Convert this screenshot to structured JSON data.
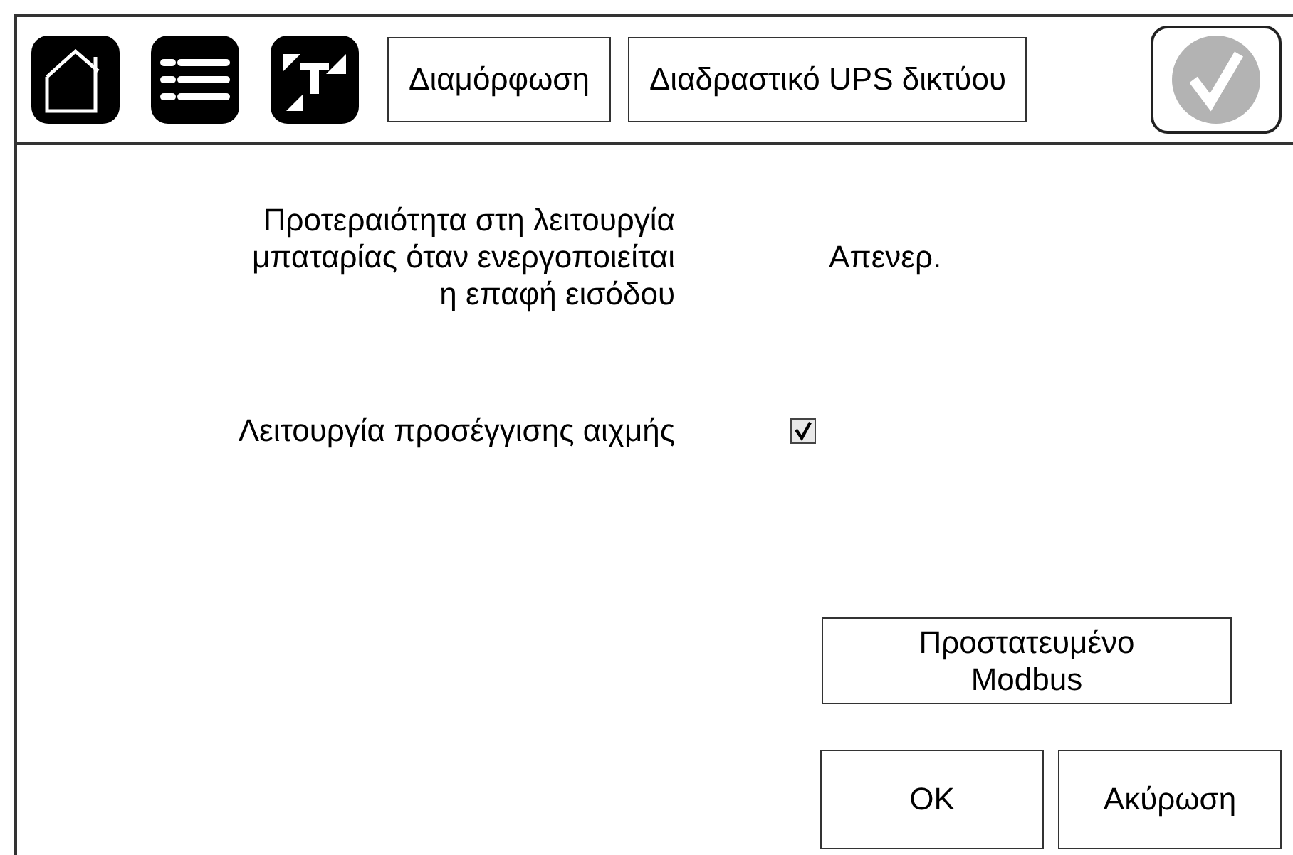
{
  "toolbar": {
    "breadcrumbs": [
      {
        "label": "Διαμόρφωση"
      },
      {
        "label": "Διαδραστικό UPS δικτύου"
      }
    ]
  },
  "settings": [
    {
      "kind": "value",
      "label": "Προτεραιότητα στη λειτουργία\nμπαταρίας όταν ενεργοποιείται\nη επαφή εισόδου",
      "value": "Απενερ."
    },
    {
      "kind": "checkbox",
      "label": "Λειτουργία προσέγγισης αιχμής",
      "checked": true
    }
  ],
  "action_button": "Προστατευμένο\nModbus",
  "dialog_buttons": [
    "OK",
    "Ακύρωση"
  ]
}
